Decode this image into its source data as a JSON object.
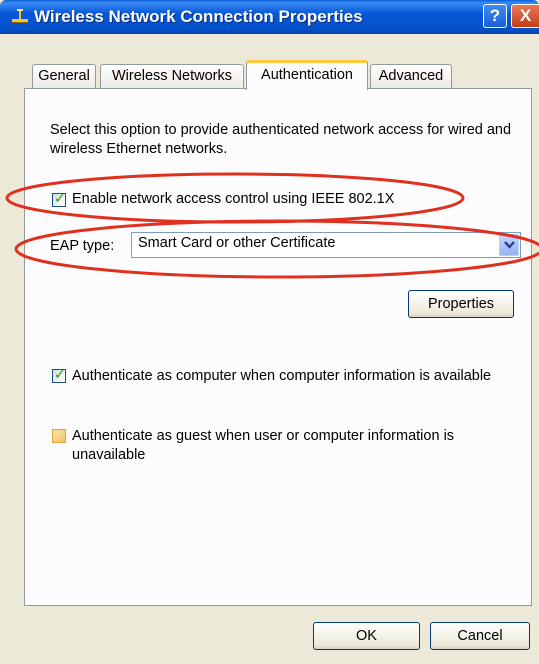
{
  "window": {
    "title": "Wireless Network Connection Properties",
    "help_label": "?",
    "close_label": "X"
  },
  "tabs": [
    {
      "label": "General",
      "active": false
    },
    {
      "label": "Wireless Networks",
      "active": false
    },
    {
      "label": "Authentication",
      "active": true
    },
    {
      "label": "Advanced",
      "active": false
    }
  ],
  "authentication": {
    "description": "Select this option to provide authenticated network access for wired and wireless Ethernet networks.",
    "enable_8021x": {
      "label": "Enable network access control using IEEE 802.1X",
      "checked": true
    },
    "eap_type": {
      "label": "EAP type:",
      "value": "Smart Card or other Certificate"
    },
    "properties_label": "Properties",
    "auth_as_computer": {
      "label": "Authenticate as computer when computer information is available",
      "checked": true
    },
    "auth_as_guest": {
      "label_line1": "Authenticate as guest when user or computer information is",
      "label_line2": "unavailable",
      "checked": false
    }
  },
  "footer": {
    "ok_label": "OK",
    "cancel_label": "Cancel"
  },
  "colors": {
    "titlebar": "#0757d8",
    "annotation": "#e0301e",
    "active_tab_highlight": "#ffc83c",
    "check_mark": "#21a121"
  }
}
